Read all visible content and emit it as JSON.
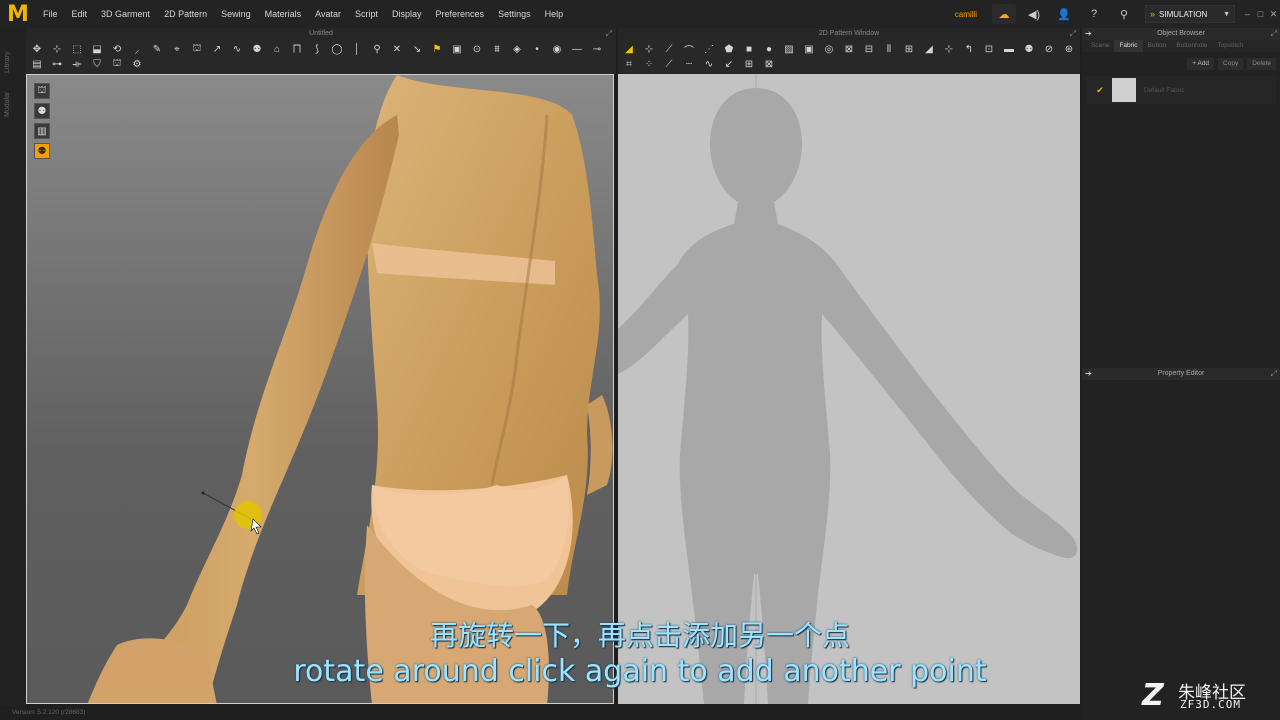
{
  "app": {
    "logo_letter": "M",
    "accent_color": "#f3b300"
  },
  "menu": [
    "File",
    "Edit",
    "3D Garment",
    "2D Pattern",
    "Sewing",
    "Materials",
    "Avatar",
    "Script",
    "Display",
    "Preferences",
    "Settings",
    "Help"
  ],
  "header_right": {
    "username": "camilli",
    "mode_label": "SIMULATION"
  },
  "panel3d": {
    "title": "Untitled"
  },
  "panel2d": {
    "title": "2D Pattern Window"
  },
  "object_browser": {
    "title": "Object Browser",
    "tabs": [
      "Scene",
      "Fabric",
      "Button",
      "Buttonhole",
      "Topstitch"
    ],
    "active_tab": "Fabric",
    "add_label": "+ Add",
    "copy_label": "Copy",
    "delete_label": "Delete",
    "fabrics": [
      {
        "name": "Default Fabric",
        "swatch": "#cfcfcf",
        "selected": true
      }
    ]
  },
  "property_editor": {
    "title": "Property Editor"
  },
  "left_strip": {
    "tabs": [
      "Library",
      "Modular"
    ]
  },
  "statusbar": {
    "version": "Version: 5.2.120 (r28683)"
  },
  "subtitles": {
    "zh": "再旋转一下，再点击添加另一个点",
    "en": "rotate around click again to add another point"
  },
  "watermark": {
    "text_cn": "朱峰社区",
    "url": "ZF3D.COM"
  }
}
